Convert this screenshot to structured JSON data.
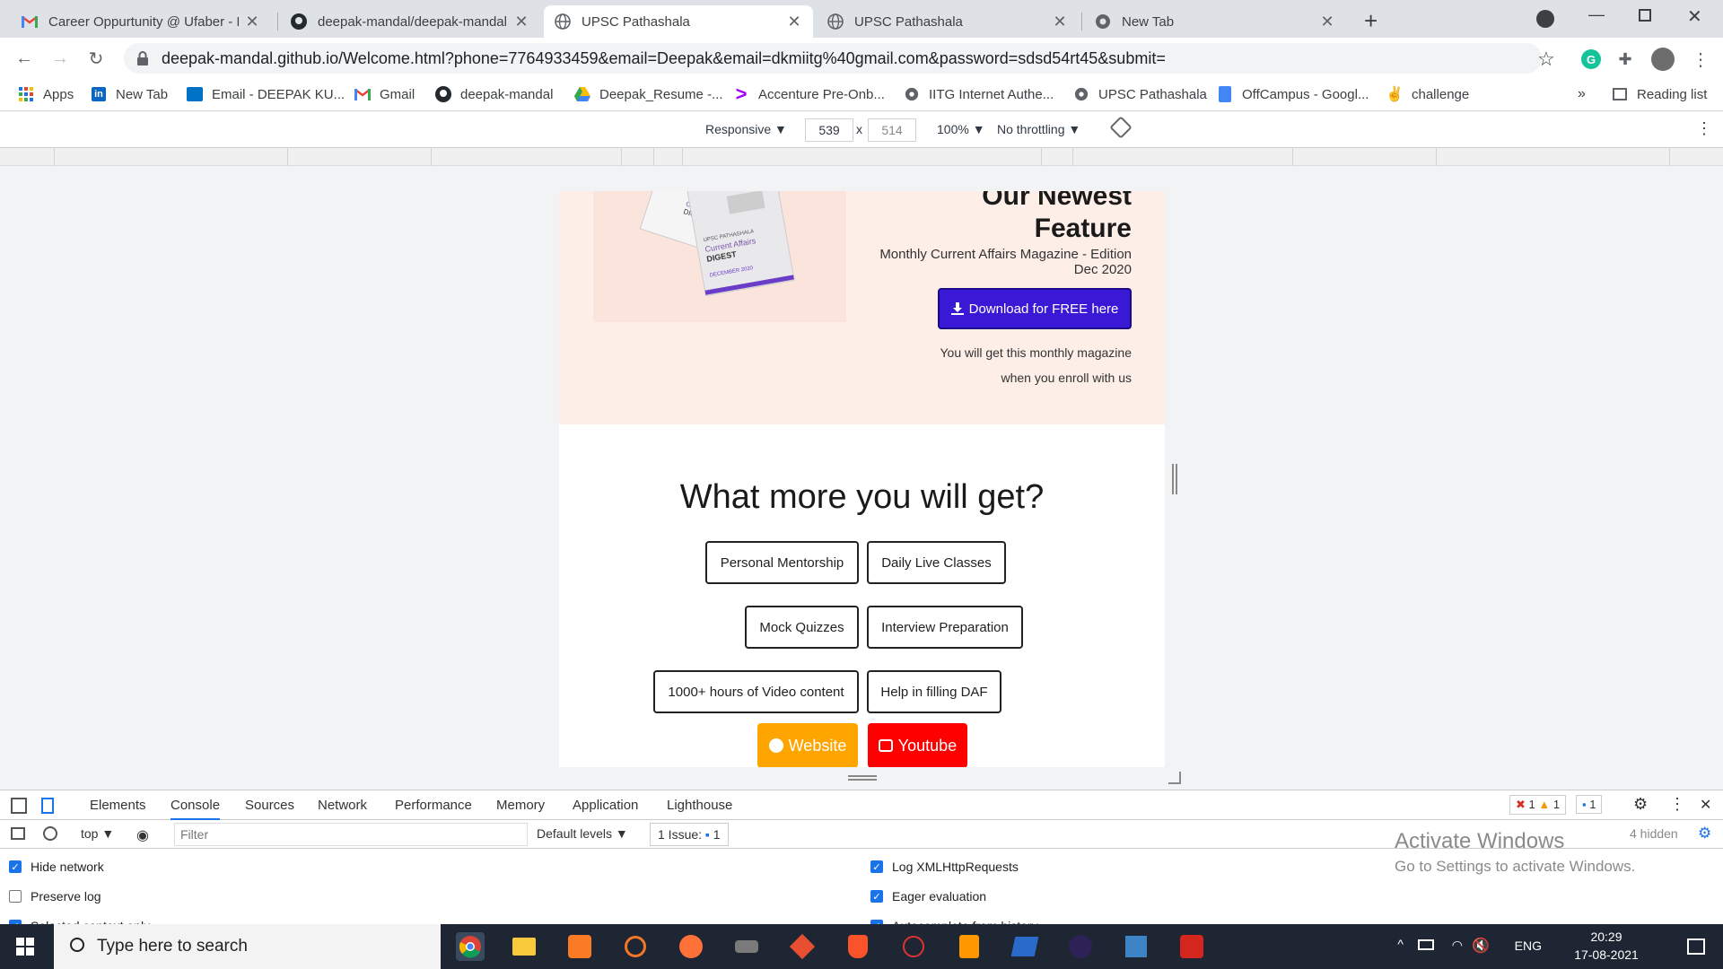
{
  "tabs": [
    {
      "title": "Career Oppurtunity @ Ufaber - F",
      "favicon": "gmail-icon",
      "active": false
    },
    {
      "title": "deepak-mandal/deepak-mandal.",
      "favicon": "github-icon",
      "active": false
    },
    {
      "title": "UPSC Pathashala",
      "favicon": "globe-icon",
      "active": true
    },
    {
      "title": "UPSC Pathashala",
      "favicon": "globe-icon",
      "active": false
    },
    {
      "title": "New Tab",
      "favicon": "chrome-icon",
      "active": false
    }
  ],
  "address_bar": {
    "url": "deepak-mandal.github.io/Welcome.html?phone=7764933459&email=Deepak&email=dkmiitg%40gmail.com&password=sdsd54rt45&submit="
  },
  "bookmarks": [
    {
      "label": "Apps",
      "icon": "apps-grid-icon"
    },
    {
      "label": "New Tab",
      "icon": "linkedin-icon"
    },
    {
      "label": "Email - DEEPAK KU...",
      "icon": "outlook-icon"
    },
    {
      "label": "Gmail",
      "icon": "gmail-icon"
    },
    {
      "label": "deepak-mandal",
      "icon": "github-icon"
    },
    {
      "label": "Deepak_Resume -...",
      "icon": "drive-icon"
    },
    {
      "label": "Accenture Pre-Onb...",
      "icon": "accenture-icon"
    },
    {
      "label": "IITG Internet Authe...",
      "icon": "globe-icon"
    },
    {
      "label": "UPSC Pathashala",
      "icon": "globe-icon"
    },
    {
      "label": "OffCampus - Googl...",
      "icon": "docs-icon"
    },
    {
      "label": "challenge",
      "icon": "challenge-icon"
    }
  ],
  "bookmarks_more": "»",
  "reading_list": "Reading list",
  "device_toolbar": {
    "mode": "Responsive",
    "width": "539",
    "x": "x",
    "height": "514",
    "zoom": "100%",
    "throttling": "No throttling"
  },
  "page": {
    "feature_title_line1": "Our Newest",
    "feature_title_line2": "Feature",
    "feature_subtitle": "Monthly Current Affairs Magazine - Edition Dec 2020",
    "download_button": "Download for FREE here",
    "note_line1": "You will get this monthly magazine",
    "note_line2": "when you enroll with us",
    "more_title": "What more you will get?",
    "pills": [
      "Personal Mentorship",
      "Daily Live Classes",
      "Mock Quizzes",
      "Interview Preparation",
      "1000+ hours of Video content",
      "Help in filling DAF"
    ],
    "website_button": "Website",
    "youtube_button": "Youtube",
    "magazine_lines": [
      "UPSC PATHASHALA",
      "Current Affairs",
      "DIGEST",
      "DECEMBER 2020"
    ]
  },
  "devtools": {
    "tabs": [
      "Elements",
      "Console",
      "Sources",
      "Network",
      "Performance",
      "Memory",
      "Application",
      "Lighthouse"
    ],
    "active_tab": "Console",
    "error_count": "1",
    "warning_count": "1",
    "message_count": "1",
    "context": "top",
    "filter_placeholder": "Filter",
    "levels": "Default levels",
    "issues": "1 Issue:",
    "issues_count": "1",
    "hidden": "4 hidden",
    "settings": [
      {
        "label": "Hide network",
        "checked": true
      },
      {
        "label": "Preserve log",
        "checked": false
      },
      {
        "label": "Selected context only",
        "checked": true
      },
      {
        "label": "Log XMLHttpRequests",
        "checked": true
      },
      {
        "label": "Eager evaluation",
        "checked": true
      },
      {
        "label": "Autocomplete from history",
        "checked": true
      }
    ]
  },
  "watermark": {
    "line1": "Activate Windows",
    "line2": "Go to Settings to activate Windows."
  },
  "taskbar": {
    "search_placeholder": "Type here to search",
    "language": "ENG",
    "time": "20:29",
    "date": "17-08-2021"
  },
  "colors": {
    "feature_bg": "#fdeee8",
    "download_btn": "#3a19d6",
    "website_btn": "#ffa500",
    "youtube_btn": "#ff0000",
    "accent": "#1a73e8"
  }
}
